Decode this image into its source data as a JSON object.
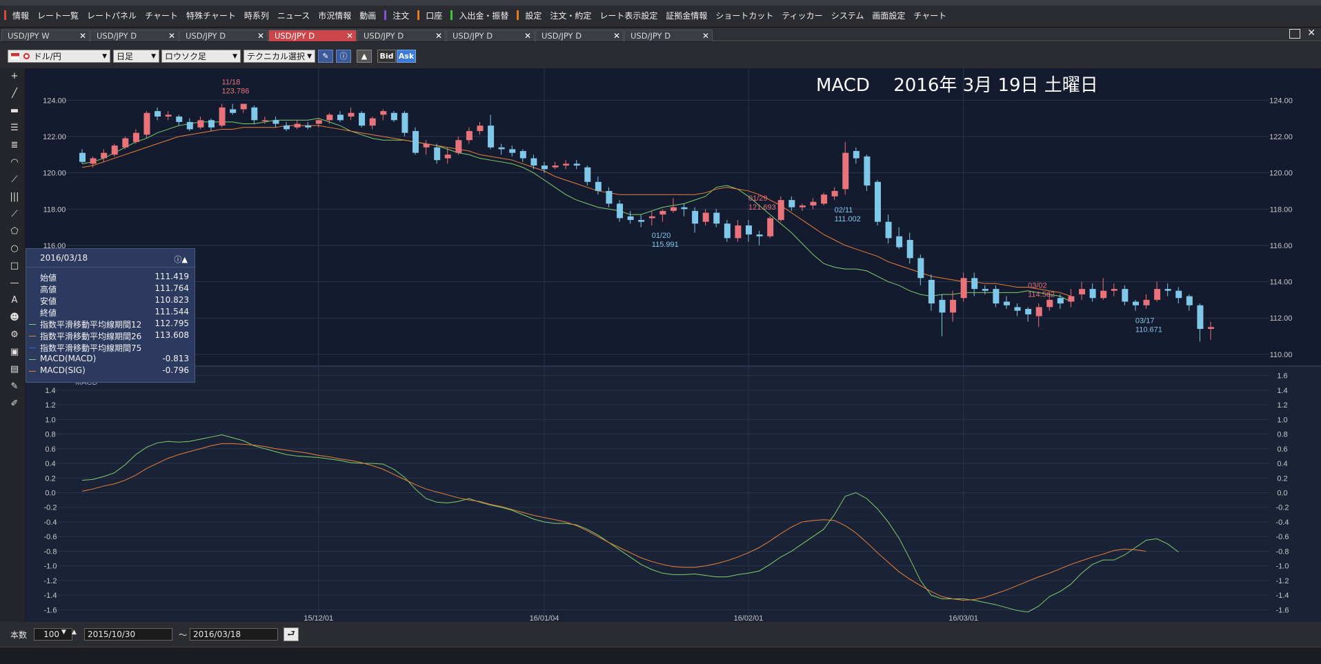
{
  "menubar": {
    "items": [
      {
        "label": "情報",
        "mark": "#e04a3a"
      },
      {
        "label": "レート一覧"
      },
      {
        "label": "レートパネル"
      },
      {
        "label": "チャート"
      },
      {
        "label": "特殊チャート"
      },
      {
        "label": "時系列"
      },
      {
        "label": "ニュース"
      },
      {
        "label": "市況情報"
      },
      {
        "label": "動画"
      },
      {
        "label": "注文",
        "mark": "#8a4fd8"
      },
      {
        "label": "口座",
        "mark": "#e87a1e"
      },
      {
        "label": "入出金・振替",
        "mark": "#3fc43a"
      },
      {
        "label": "設定",
        "mark": "#e87a1e"
      },
      {
        "label": "注文・約定"
      },
      {
        "label": "レート表示設定"
      },
      {
        "label": "証拠金情報"
      },
      {
        "label": "ショートカット"
      },
      {
        "label": "ティッカー"
      },
      {
        "label": "システム"
      },
      {
        "label": "画面設定"
      },
      {
        "label": "チャート"
      }
    ]
  },
  "tabs": [
    {
      "label": "USD/JPY W",
      "active": false
    },
    {
      "label": "USD/JPY D",
      "active": false
    },
    {
      "label": "USD/JPY D",
      "active": false
    },
    {
      "label": "USD/JPY D",
      "active": true
    },
    {
      "label": "USD/JPY D",
      "active": false
    },
    {
      "label": "USD/JPY D",
      "active": false
    },
    {
      "label": "USD/JPY D",
      "active": false
    },
    {
      "label": "USD/JPY D",
      "active": false
    }
  ],
  "toolbar": {
    "currency": "ドル/円",
    "period": "日足",
    "chart_style": "ロウソク足",
    "technical": "テクニカル選択",
    "bid": "Bid",
    "ask": "Ask"
  },
  "chart_title": "MACD　 2016年 3月 19日 土曜日",
  "price_axis": {
    "ticks": [
      "124.00",
      "122.00",
      "120.00",
      "118.00",
      "116.00",
      "114.00",
      "112.00",
      "110.00"
    ],
    "ylim": [
      109.5,
      125.0
    ]
  },
  "macd_axis": {
    "label": "MACD",
    "ticks": [
      "1.6",
      "1.4",
      "1.2",
      "1.0",
      "0.8",
      "0.6",
      "0.4",
      "0.2",
      "0.0",
      "-0.2",
      "-0.4",
      "-0.6",
      "-0.8",
      "-1.0",
      "-1.2",
      "-1.4",
      "-1.6"
    ],
    "ylim": [
      -1.7,
      1.7
    ]
  },
  "x_axis": {
    "ticks": [
      "15/12/01",
      "16/01/04",
      "16/02/01",
      "16/03/01"
    ]
  },
  "annotations": [
    {
      "date": "11/18",
      "value": "123.786",
      "kind": "high"
    },
    {
      "date": "01/20",
      "value": "115.991",
      "kind": "low"
    },
    {
      "date": "01/29",
      "value": "121.693",
      "kind": "high"
    },
    {
      "date": "02/11",
      "value": "111.002",
      "kind": "low"
    },
    {
      "date": "03/02",
      "value": "114.562",
      "kind": "high"
    },
    {
      "date": "03/17",
      "value": "110.671",
      "kind": "low"
    }
  ],
  "infobox": {
    "date": "2016/03/18",
    "rows": [
      {
        "label": "始値",
        "value": "111.419",
        "swatch": ""
      },
      {
        "label": "高値",
        "value": "111.764",
        "swatch": ""
      },
      {
        "label": "安値",
        "value": "110.823",
        "swatch": ""
      },
      {
        "label": "終値",
        "value": "111.544",
        "swatch": ""
      },
      {
        "label": "指数平滑移動平均線期間12",
        "value": "112.795",
        "swatch": "#7fd06a"
      },
      {
        "label": "指数平滑移動平均線期間26",
        "value": "113.608",
        "swatch": "#e8823a"
      },
      {
        "label": "指数平滑移動平均線期間75",
        "value": "",
        "swatch": "#3b64d8"
      },
      {
        "label": "MACD(MACD)",
        "value": "-0.813",
        "swatch": "#7fd06a"
      },
      {
        "label": "MACD(SIG)",
        "value": "-0.796",
        "swatch": "#e8823a"
      }
    ]
  },
  "bottombar": {
    "count_label": "本数",
    "count_value": "100",
    "from_date": "2015/10/30",
    "tilde": "～",
    "to_date": "2016/03/18"
  },
  "chart_data": {
    "type": "candlestick",
    "title": "MACD　 2016年 3月 19日 土曜日",
    "series": [
      {
        "name": "指数平滑移動平均線期間12",
        "color": "#7fd06a",
        "values": [
          120.5,
          120.6,
          120.8,
          121.1,
          121.4,
          121.7,
          121.9,
          122.2,
          122.4,
          122.6,
          122.7,
          122.8,
          122.8,
          122.8,
          122.8,
          122.7,
          122.7,
          122.8,
          122.9,
          122.9,
          122.9,
          122.9,
          123.0,
          122.8,
          122.6,
          122.3,
          122.1,
          121.9,
          121.8,
          121.8,
          121.8,
          121.7,
          121.6,
          121.5,
          121.3,
          121.1,
          121.0,
          120.8,
          120.7,
          120.6,
          120.5,
          120.3,
          120.0,
          119.6,
          119.2,
          118.8,
          118.5,
          118.3,
          118.1,
          118.0,
          117.9,
          117.7,
          117.7,
          117.9,
          118.1,
          118.2,
          118.3,
          118.5,
          118.7,
          119.2,
          119.3,
          119.1,
          118.7,
          118.2,
          117.7,
          117.2,
          116.7,
          116.1,
          115.5,
          115.0,
          114.8,
          114.7,
          114.7,
          114.6,
          114.3,
          114.0,
          113.8,
          113.5,
          113.3,
          113.2,
          113.3,
          113.3,
          113.4,
          113.4,
          113.4,
          113.4,
          113.4,
          113.4,
          113.5,
          113.4,
          113.3,
          113.2,
          112.9
        ]
      },
      {
        "name": "指数平滑移動平均線期間26",
        "color": "#e8823a",
        "values": [
          120.3,
          120.4,
          120.6,
          120.8,
          121.0,
          121.2,
          121.4,
          121.6,
          121.8,
          122.0,
          122.1,
          122.2,
          122.3,
          122.4,
          122.4,
          122.5,
          122.5,
          122.5,
          122.5,
          122.6,
          122.6,
          122.6,
          122.6,
          122.5,
          122.4,
          122.3,
          122.2,
          122.1,
          122.0,
          121.9,
          121.8,
          121.7,
          121.6,
          121.5,
          121.4,
          121.3,
          121.2,
          121.0,
          120.9,
          120.8,
          120.7,
          120.5,
          120.3,
          120.1,
          119.8,
          119.6,
          119.4,
          119.2,
          119.0,
          118.9,
          118.8,
          118.8,
          118.8,
          118.8,
          118.8,
          118.8,
          118.8,
          118.8,
          118.9,
          119.1,
          119.2,
          119.1,
          119.0,
          118.8,
          118.5,
          118.2,
          117.8,
          117.4,
          117.0,
          116.6,
          116.3,
          116.0,
          115.8,
          115.6,
          115.4,
          115.1,
          114.9,
          114.7,
          114.5,
          114.3,
          114.2,
          114.1,
          114.0,
          114.0,
          113.9,
          113.9,
          113.8,
          113.7,
          113.7,
          113.6,
          113.5,
          113.4,
          113.2
        ]
      }
    ],
    "candles": [
      [
        121.1,
        120.6,
        121.3,
        120.5
      ],
      [
        120.5,
        120.8,
        120.9,
        120.3
      ],
      [
        120.8,
        121.1,
        121.3,
        120.6
      ],
      [
        121.0,
        121.5,
        121.6,
        120.9
      ],
      [
        121.4,
        121.9,
        122.0,
        121.3
      ],
      [
        121.7,
        122.2,
        122.4,
        121.6
      ],
      [
        122.1,
        123.3,
        123.4,
        121.9
      ],
      [
        123.4,
        123.1,
        123.6,
        122.9
      ],
      [
        123.1,
        123.2,
        123.4,
        122.9
      ],
      [
        123.1,
        122.8,
        123.2,
        122.6
      ],
      [
        122.8,
        122.4,
        123.0,
        122.3
      ],
      [
        122.5,
        122.9,
        123.1,
        122.4
      ],
      [
        122.9,
        122.5,
        123.0,
        122.3
      ],
      [
        122.6,
        123.6,
        123.8,
        122.5
      ],
      [
        123.5,
        123.3,
        123.8,
        123.2
      ],
      [
        123.5,
        123.8,
        123.8,
        123.3
      ],
      [
        123.6,
        122.9,
        123.7,
        122.7
      ],
      [
        122.9,
        122.9,
        123.1,
        122.7
      ],
      [
        122.9,
        122.7,
        123.1,
        122.5
      ],
      [
        122.6,
        122.4,
        122.8,
        122.3
      ],
      [
        122.5,
        122.7,
        122.9,
        122.4
      ],
      [
        122.6,
        122.5,
        122.8,
        122.4
      ],
      [
        122.7,
        122.9,
        123.0,
        122.5
      ],
      [
        122.9,
        123.2,
        123.3,
        122.7
      ],
      [
        123.2,
        122.9,
        123.4,
        122.8
      ],
      [
        123.1,
        123.3,
        123.6,
        122.9
      ],
      [
        123.3,
        122.6,
        123.4,
        122.5
      ],
      [
        122.6,
        123.0,
        123.1,
        122.4
      ],
      [
        123.2,
        123.4,
        123.5,
        122.9
      ],
      [
        123.3,
        122.9,
        123.4,
        122.8
      ],
      [
        123.3,
        122.2,
        123.4,
        122.0
      ],
      [
        122.3,
        121.1,
        122.5,
        121.0
      ],
      [
        121.4,
        121.6,
        121.8,
        121.0
      ],
      [
        121.4,
        120.7,
        121.6,
        120.5
      ],
      [
        120.8,
        121.0,
        121.4,
        120.5
      ],
      [
        121.1,
        121.8,
        122.0,
        121.0
      ],
      [
        121.8,
        122.3,
        122.5,
        121.6
      ],
      [
        122.3,
        122.6,
        122.8,
        122.1
      ],
      [
        122.6,
        121.4,
        123.2,
        121.3
      ],
      [
        121.4,
        121.3,
        121.6,
        121.0
      ],
      [
        121.3,
        121.1,
        121.5,
        120.9
      ],
      [
        121.2,
        120.8,
        121.3,
        120.6
      ],
      [
        120.8,
        120.4,
        121.0,
        120.2
      ],
      [
        120.4,
        120.2,
        120.6,
        120.0
      ],
      [
        120.3,
        120.4,
        120.6,
        120.2
      ],
      [
        120.4,
        120.5,
        120.7,
        120.2
      ],
      [
        120.5,
        120.4,
        120.7,
        120.2
      ],
      [
        120.3,
        119.5,
        120.4,
        119.3
      ],
      [
        119.5,
        119.0,
        119.8,
        118.8
      ],
      [
        119.0,
        118.3,
        119.2,
        118.1
      ],
      [
        118.3,
        117.5,
        118.5,
        117.3
      ],
      [
        117.6,
        117.4,
        117.9,
        117.2
      ],
      [
        117.4,
        117.3,
        117.7,
        117.0
      ],
      [
        117.5,
        117.6,
        117.9,
        117.1
      ],
      [
        117.7,
        117.9,
        118.0,
        117.3
      ],
      [
        117.9,
        118.1,
        118.6,
        117.8
      ],
      [
        118.1,
        118.0,
        118.3,
        117.6
      ],
      [
        117.9,
        117.2,
        118.1,
        116.7
      ],
      [
        117.3,
        117.8,
        118.0,
        117.1
      ],
      [
        117.8,
        117.2,
        118.0,
        117.0
      ],
      [
        117.2,
        116.4,
        117.4,
        116.2
      ],
      [
        116.4,
        117.1,
        117.4,
        116.2
      ],
      [
        117.1,
        116.6,
        117.4,
        116.2
      ],
      [
        116.6,
        116.5,
        116.8,
        116.0
      ],
      [
        116.5,
        117.5,
        117.6,
        116.4
      ],
      [
        117.4,
        118.5,
        118.7,
        117.3
      ],
      [
        118.5,
        118.1,
        118.7,
        117.9
      ],
      [
        118.1,
        118.2,
        118.3,
        117.9
      ],
      [
        118.2,
        118.4,
        118.6,
        118.0
      ],
      [
        118.3,
        118.8,
        118.9,
        118.2
      ],
      [
        118.7,
        119.0,
        119.2,
        118.5
      ],
      [
        119.1,
        121.1,
        121.7,
        118.8
      ],
      [
        121.2,
        120.8,
        121.4,
        120.5
      ],
      [
        120.9,
        119.3,
        121.0,
        119.0
      ],
      [
        119.5,
        117.3,
        119.6,
        117.1
      ],
      [
        117.3,
        116.4,
        117.7,
        116.1
      ],
      [
        116.5,
        115.9,
        117.0,
        115.8
      ],
      [
        116.3,
        115.3,
        116.7,
        115.0
      ],
      [
        115.3,
        114.2,
        115.5,
        113.8
      ],
      [
        114.1,
        112.8,
        114.4,
        112.4
      ],
      [
        113.0,
        112.3,
        113.3,
        111.0
      ],
      [
        112.3,
        113.0,
        113.5,
        111.8
      ],
      [
        113.1,
        114.2,
        114.5,
        112.9
      ],
      [
        114.2,
        113.6,
        114.5,
        113.2
      ],
      [
        113.6,
        113.5,
        113.8,
        113.3
      ],
      [
        113.6,
        112.8,
        113.8,
        112.6
      ],
      [
        112.9,
        112.7,
        113.2,
        112.5
      ],
      [
        112.6,
        112.4,
        112.8,
        112.1
      ],
      [
        112.5,
        112.2,
        112.6,
        111.8
      ],
      [
        112.1,
        112.6,
        112.8,
        111.5
      ],
      [
        112.6,
        113.0,
        113.4,
        112.4
      ],
      [
        113.1,
        112.8,
        113.3,
        112.5
      ],
      [
        112.9,
        113.2,
        113.6,
        112.6
      ],
      [
        113.3,
        113.6,
        114.0,
        113.0
      ],
      [
        113.6,
        113.1,
        113.9,
        112.9
      ],
      [
        113.1,
        113.5,
        114.2,
        113.0
      ],
      [
        113.5,
        113.6,
        113.9,
        113.2
      ],
      [
        113.6,
        112.9,
        113.8,
        112.7
      ],
      [
        112.9,
        112.7,
        113.0,
        112.4
      ],
      [
        112.7,
        113.0,
        113.3,
        112.5
      ],
      [
        113.0,
        113.6,
        114.0,
        112.9
      ],
      [
        113.6,
        113.5,
        113.9,
        113.2
      ],
      [
        113.5,
        113.1,
        113.7,
        112.8
      ],
      [
        113.2,
        112.7,
        113.3,
        112.4
      ],
      [
        112.7,
        111.4,
        112.8,
        110.7
      ],
      [
        111.4,
        111.5,
        111.8,
        110.8
      ]
    ],
    "macd": [
      0.17,
      0.18,
      0.22,
      0.27,
      0.38,
      0.52,
      0.62,
      0.68,
      0.7,
      0.69,
      0.7,
      0.73,
      0.76,
      0.79,
      0.75,
      0.71,
      0.64,
      0.6,
      0.56,
      0.52,
      0.5,
      0.49,
      0.48,
      0.46,
      0.44,
      0.41,
      0.4,
      0.4,
      0.39,
      0.32,
      0.21,
      0.05,
      -0.08,
      -0.13,
      -0.14,
      -0.12,
      -0.08,
      -0.13,
      -0.17,
      -0.2,
      -0.24,
      -0.3,
      -0.36,
      -0.4,
      -0.42,
      -0.42,
      -0.44,
      -0.5,
      -0.58,
      -0.68,
      -0.78,
      -0.88,
      -0.98,
      -1.05,
      -1.1,
      -1.12,
      -1.12,
      -1.11,
      -1.13,
      -1.15,
      -1.15,
      -1.12,
      -1.1,
      -1.07,
      -0.98,
      -0.88,
      -0.8,
      -0.7,
      -0.6,
      -0.5,
      -0.3,
      -0.05,
      0.0,
      -0.08,
      -0.22,
      -0.4,
      -0.62,
      -0.9,
      -1.2,
      -1.4,
      -1.45,
      -1.45,
      -1.45,
      -1.47,
      -1.5,
      -1.53,
      -1.57,
      -1.61,
      -1.63,
      -1.55,
      -1.42,
      -1.35,
      -1.25,
      -1.1,
      -0.98,
      -0.92,
      -0.92,
      -0.85,
      -0.75,
      -0.65,
      -0.63,
      -0.7,
      -0.81
    ],
    "signal": [
      0.02,
      0.05,
      0.09,
      0.12,
      0.17,
      0.24,
      0.33,
      0.4,
      0.47,
      0.52,
      0.56,
      0.6,
      0.64,
      0.67,
      0.67,
      0.66,
      0.65,
      0.63,
      0.6,
      0.58,
      0.56,
      0.54,
      0.51,
      0.49,
      0.46,
      0.44,
      0.41,
      0.37,
      0.32,
      0.25,
      0.18,
      0.11,
      0.05,
      0.01,
      -0.03,
      -0.07,
      -0.1,
      -0.12,
      -0.16,
      -0.19,
      -0.23,
      -0.27,
      -0.31,
      -0.34,
      -0.37,
      -0.4,
      -0.45,
      -0.52,
      -0.6,
      -0.68,
      -0.75,
      -0.82,
      -0.89,
      -0.94,
      -0.98,
      -1.01,
      -1.02,
      -1.02,
      -1.0,
      -0.97,
      -0.93,
      -0.88,
      -0.82,
      -0.75,
      -0.66,
      -0.56,
      -0.47,
      -0.4,
      -0.38,
      -0.37,
      -0.38,
      -0.45,
      -0.55,
      -0.68,
      -0.82,
      -0.95,
      -1.08,
      -1.18,
      -1.27,
      -1.35,
      -1.42,
      -1.45,
      -1.47,
      -1.46,
      -1.43,
      -1.38,
      -1.33,
      -1.27,
      -1.21,
      -1.15,
      -1.1,
      -1.04,
      -0.98,
      -0.93,
      -0.88,
      -0.84,
      -0.79,
      -0.77,
      -0.78,
      -0.8
    ],
    "ylim_price": [
      109.5,
      125.0
    ],
    "ylim_macd": [
      -1.7,
      1.7
    ]
  }
}
